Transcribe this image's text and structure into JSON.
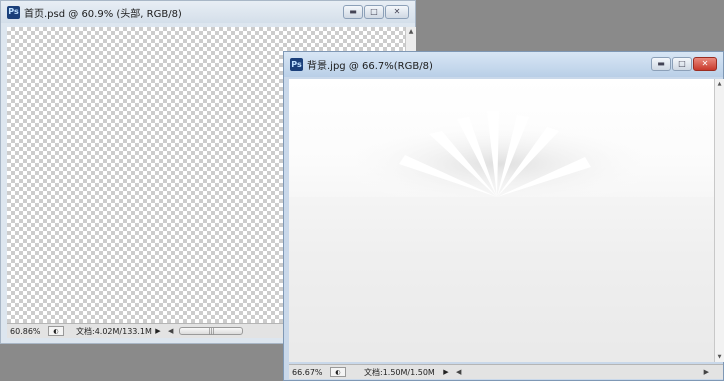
{
  "window_psd": {
    "title": "首页.psd @ 60.9% (头部, RGB/8)",
    "icon": "photoshop-doc-icon",
    "controls": [
      "minimize-icon",
      "maximize-icon",
      "close-icon"
    ],
    "status": {
      "zoom": "60.86%",
      "doc_info": "文档:4.02M/133.1M"
    }
  },
  "window_jpg": {
    "title": "背景.jpg @ 66.7%(RGB/8)",
    "icon": "photoshop-doc-icon",
    "controls": [
      "minimize-icon",
      "maximize-icon",
      "close-icon"
    ],
    "status": {
      "zoom": "66.67%",
      "doc_info": "文档:1.50M/1.50M"
    }
  },
  "colors": {
    "workspace": "#8a8a8a",
    "active_title": "#c7dcf3",
    "inactive_title": "#d9e4ef",
    "close_active": "#d9534f"
  }
}
